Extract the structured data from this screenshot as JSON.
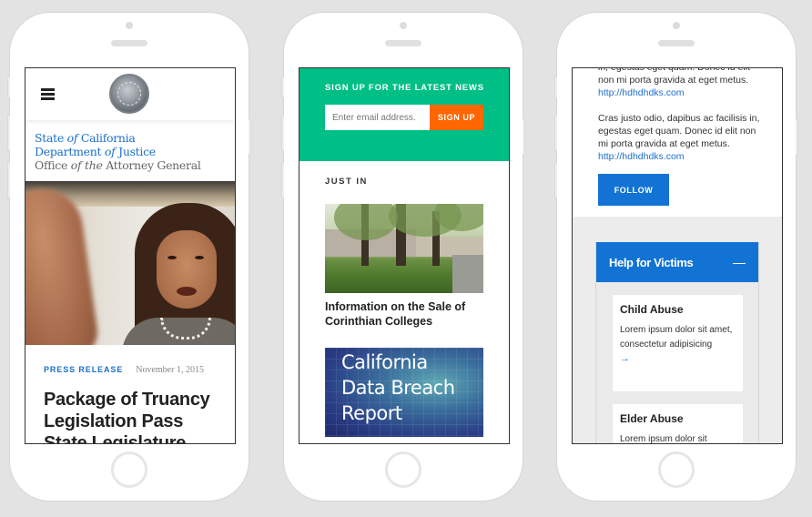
{
  "phones": {
    "home": {
      "menu_icon": "hamburger-icon",
      "seal_icon": "state-seal-icon",
      "title_line1_a": "State ",
      "title_line1_of": "of",
      "title_line1_b": " California",
      "title_line2_a": "Department ",
      "title_line2_of": "of",
      "title_line2_b": " Justice",
      "title_line3_a": "Office ",
      "title_line3_of": "of the",
      "title_line3_b": " Attorney General",
      "article": {
        "tag": "PRESS RELEASE",
        "date": "November 1, 2015",
        "headline": "Package of Truancy Legislation Pass State Legislature"
      }
    },
    "news": {
      "signup": {
        "title": "SIGN UP FOR THE LATEST NEWS",
        "email_placeholder": "Enter email address.",
        "button_label": "SIGN UP",
        "bg_color": "#00bf86",
        "button_color": "#ff6600"
      },
      "section_title": "JUST IN",
      "items": [
        {
          "caption": "Information on the Sale of Corinthian Colleges"
        },
        {
          "image_text": [
            "California",
            "Data Breach",
            "Report"
          ]
        }
      ]
    },
    "victims": {
      "paragraphs": [
        {
          "text": "in, egestas eget quam. Donec id elit non mi porta gravida at eget metus.",
          "link": "http://hdhdhdks.com"
        },
        {
          "text": "Cras justo odio, dapibus ac facilisis in, egestas eget quam. Donec id elit non mi porta gravida at eget metus.",
          "link": "http://hdhdhdks.com"
        }
      ],
      "follow_label": "FOLLOW",
      "panel": {
        "title": "Help for Victims",
        "collapse_symbol": "—",
        "accent_color": "#1273d4",
        "cards": [
          {
            "title": "Child Abuse",
            "text": "Lorem ipsum dolor sit amet, consectetur adipisicing",
            "arrow": "→"
          },
          {
            "title": "Elder Abuse",
            "text": "Lorem ipsum dolor sit"
          }
        ]
      }
    }
  }
}
